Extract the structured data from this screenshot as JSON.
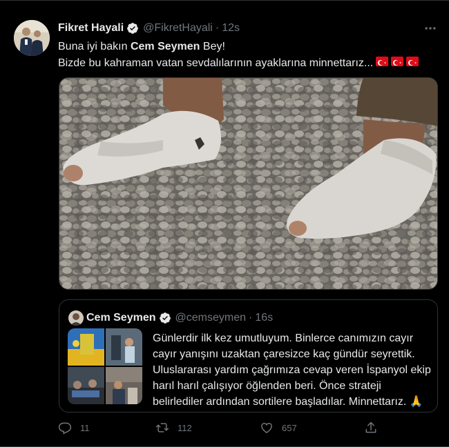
{
  "tweet": {
    "author_name": "Fikret Hayali",
    "author_handle": "@FikretHayali",
    "separator": "·",
    "time": "12s",
    "line1_prefix": "Buna iyi bakın ",
    "line1_bold": "Cem Seymen",
    "line1_suffix": " Bey!",
    "line2": "Bizde bu kahraman vatan sevdalılarının ayaklarına   minnettarız...",
    "flags": [
      "turkey-flag",
      "turkey-flag",
      "turkey-flag"
    ]
  },
  "quote": {
    "author_name": "Cem Seymen",
    "author_handle": "@cemseymen",
    "separator": "·",
    "time": "16s",
    "text": "Günlerdir ilk kez umutluyum. Binlerce canımızın cayır cayır yanışını uzaktan çaresizce kaç gündür seyrettik. Uluslararası yardım çağrımıza cevap veren İspanyol ekip harıl harıl çalışıyor öğlenden beri. Önce strateji belirlediler ardından sortilere başladılar. Minnettarız. 🙏"
  },
  "actions": {
    "replies": "11",
    "retweets": "112",
    "likes": "657"
  },
  "colors": {
    "background": "#000000",
    "text": "#e7e9ea",
    "secondary": "#71767b",
    "border": "#2f3336",
    "verified_badge": "#e7e9ea",
    "flag_red": "#e30a17"
  }
}
